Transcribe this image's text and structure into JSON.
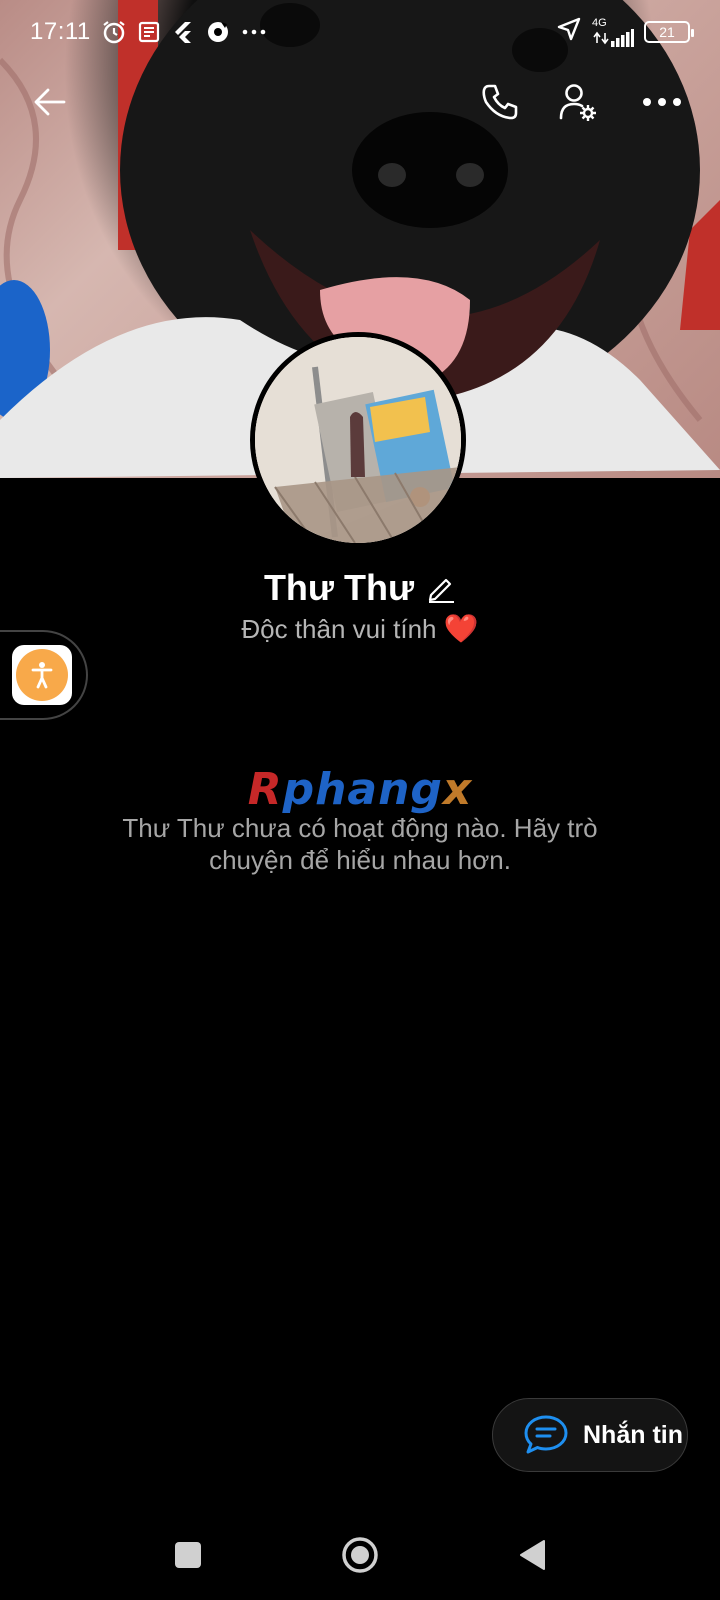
{
  "status_bar": {
    "time": "17:11",
    "network_label": "4G",
    "battery": "21"
  },
  "profile": {
    "name": "Thư Thư",
    "bio": "Độc thân vui tính",
    "bio_emoji": "❤️"
  },
  "watermark": {
    "part_a": "R",
    "part_b": "phang",
    "part_c": "x"
  },
  "activity": {
    "empty_message": "Thư Thư chưa có hoạt động nào. Hãy trò chuyện để hiểu nhau hơn."
  },
  "message_button": {
    "label": "Nhắn tin"
  },
  "icons": {
    "back": "arrow-left-icon",
    "call": "phone-icon",
    "settings": "user-settings-icon",
    "more": "more-horizontal-icon",
    "edit": "pencil-icon",
    "chat": "chat-bubble-icon",
    "accessibility": "accessibility-icon"
  },
  "colors": {
    "background": "#000000",
    "accent_blue": "#1e8ff0",
    "accessibility_orange": "#f8a94a",
    "heart": "#e53935"
  }
}
